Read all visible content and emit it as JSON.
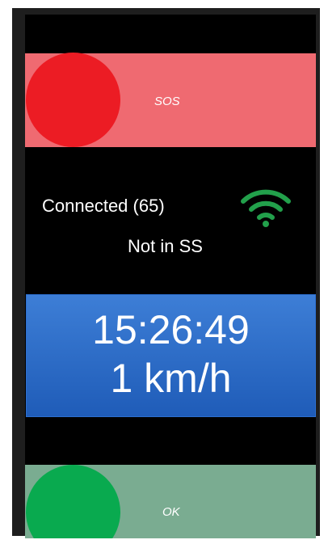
{
  "sos": {
    "label": "SOS",
    "color": "#ef6a71",
    "knob_color": "#ec1c24"
  },
  "status": {
    "connection": "Connected (65)",
    "ss_state": "Not in SS",
    "wifi_icon": "wifi-icon",
    "wifi_color": "#22a04b"
  },
  "clock": {
    "time": "15:26:49",
    "speed": "1 km/h"
  },
  "ok": {
    "label": "OK",
    "color": "#7aac91",
    "knob_color": "#09aa4f"
  }
}
